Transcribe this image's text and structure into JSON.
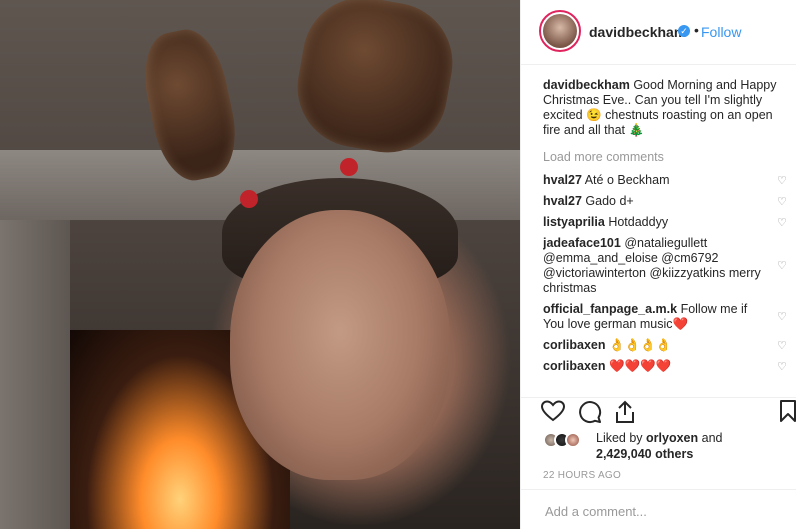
{
  "post": {
    "username": "davidbeckham",
    "follow_label": "Follow",
    "separator": "•",
    "verified_glyph": "✓"
  },
  "caption": {
    "username": "davidbeckham",
    "text": "Good Morning and Happy Christmas Eve.. Can you tell I'm slightly excited 😉 chestnuts roasting on an open fire and all that 🎄"
  },
  "load_more_label": "Load more comments",
  "comments": [
    {
      "user": "hval27",
      "text": "Até o Beckham"
    },
    {
      "user": "hval27",
      "text": "Gado d+"
    },
    {
      "user": "listyaprilia",
      "text": "Hotdaddyy"
    },
    {
      "user": "jadeaface101",
      "text": "@nataliegullett @emma_and_eloise @cm6792 @victoriawinterton @kiizzyatkins merry christmas"
    },
    {
      "user": "official_fanpage_a.m.k",
      "text": "Follow me if You love german music❤️"
    },
    {
      "user": "corlibaxen",
      "text": "👌👌👌👌"
    },
    {
      "user": "corlibaxen",
      "text": "❤️❤️❤️❤️"
    }
  ],
  "icons": {
    "heart": "heart-icon",
    "comment": "comment-icon",
    "share": "share-icon",
    "save": "bookmark-icon"
  },
  "likes": {
    "prefix": "Liked by",
    "user": "orlyoxen",
    "suffix": "and",
    "count_text": "2,429,040 others"
  },
  "timestamp": "22 HOURS AGO",
  "add_comment_placeholder": "Add a comment..."
}
